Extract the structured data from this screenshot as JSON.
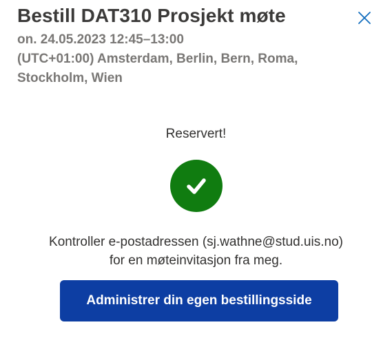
{
  "header": {
    "title": "Bestill DAT310 Prosjekt møte",
    "date_time": "on. 24.05.2023 12:45–13:00",
    "timezone": "(UTC+01:00) Amsterdam, Berlin, Bern, Roma, Stockholm, Wien",
    "close_icon": "close-icon"
  },
  "confirmation": {
    "status": "Reservert!",
    "icon": "checkmark-icon",
    "icon_color": "#107c10",
    "message_line1": "Kontroller e-postadressen (sj.wathne@stud.uis.no)",
    "message_line2": "for en møteinvitasjon fra meg."
  },
  "actions": {
    "manage_label": "Administrer din egen bestillingsside",
    "manage_color": "#0d3ea3"
  }
}
